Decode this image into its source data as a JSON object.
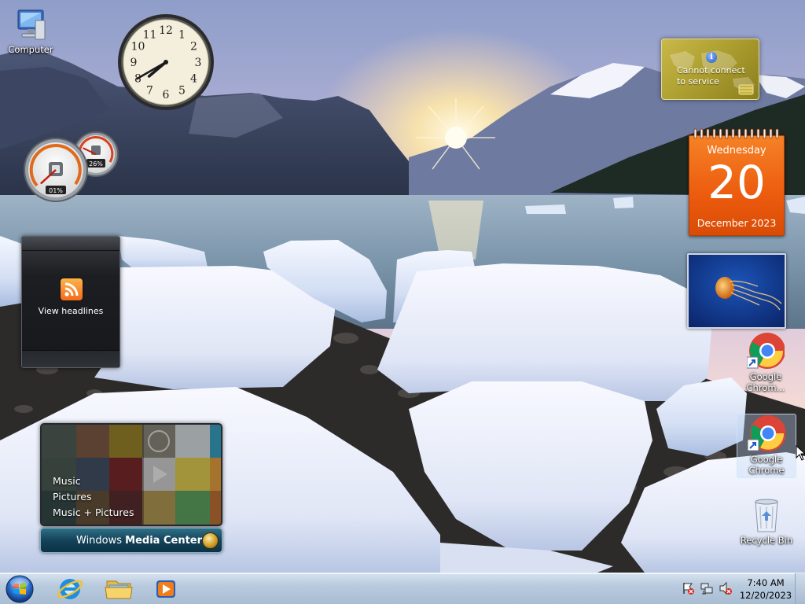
{
  "desktop": {
    "icons": {
      "computer": {
        "label": "Computer"
      },
      "chrome_1": {
        "label": "Google Chrom..."
      },
      "chrome_2": {
        "label": "Google Chrome"
      },
      "recycle_bin": {
        "label": "Recycle Bin"
      }
    }
  },
  "gadgets": {
    "clock": {
      "numerals": [
        "12",
        "1",
        "2",
        "3",
        "4",
        "5",
        "6",
        "7",
        "8",
        "9",
        "10",
        "11"
      ],
      "time": "7:40"
    },
    "cpu_meter": {
      "cpu": "01%",
      "memory": "26%",
      "cpu_value": 0.01,
      "memory_value": 0.26
    },
    "feed_headlines": {
      "label": "View headlines",
      "icon": "rss-icon"
    },
    "weather": {
      "message": "Cannot connect to service",
      "icon": "info-icon"
    },
    "calendar": {
      "weekday": "Wednesday",
      "day": "20",
      "month_year": "December 2023"
    },
    "slideshow": {
      "subject": "jellyfish"
    },
    "media_center": {
      "menu": [
        "Music",
        "Pictures",
        "Music + Pictures"
      ],
      "title_thin": "Windows",
      "title_bold": "Media Center"
    }
  },
  "taskbar": {
    "start": {
      "icon": "windows-orb-icon"
    },
    "pinned": [
      {
        "name": "Internet Explorer",
        "icon": "internet-explorer-icon"
      },
      {
        "name": "Windows Explorer",
        "icon": "folder-icon"
      },
      {
        "name": "Windows Media Player",
        "icon": "media-player-icon"
      }
    ],
    "tray": {
      "icons": [
        "action-center-icon",
        "network-icon",
        "volume-muted-icon"
      ]
    },
    "clock": {
      "time": "7:40 AM",
      "date": "12/20/2023"
    }
  }
}
